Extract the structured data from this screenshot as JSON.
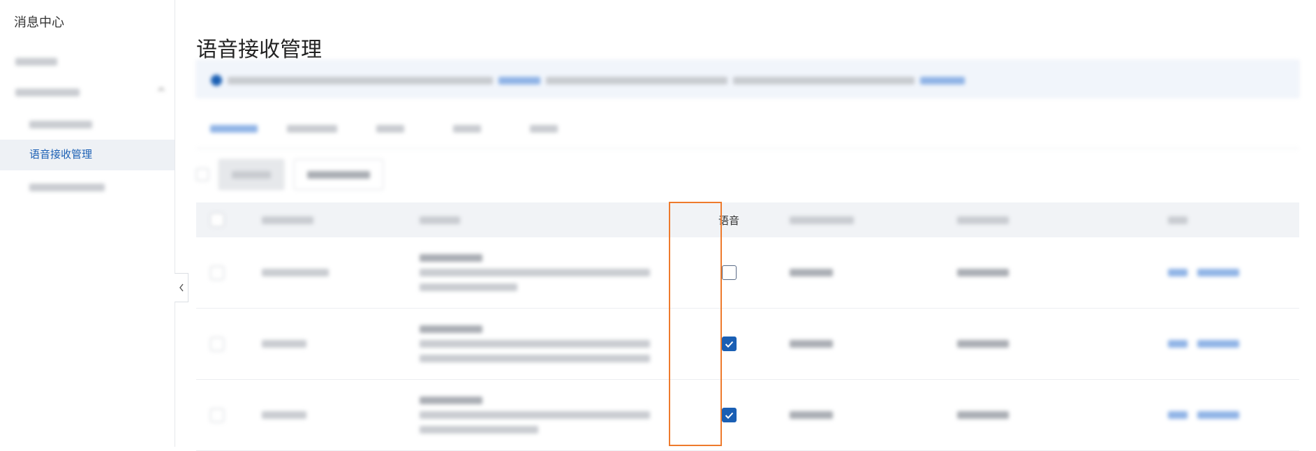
{
  "sidebar": {
    "title": "消息中心",
    "active_item": "语音接收管理"
  },
  "main": {
    "page_title": "语音接收管理",
    "table": {
      "voice_column": "语音",
      "rows": [
        {
          "voice_checked": false
        },
        {
          "voice_checked": true
        },
        {
          "voice_checked": true
        }
      ]
    }
  },
  "colors": {
    "accent": "#1a5fb4",
    "highlight": "#ee7a2c"
  }
}
